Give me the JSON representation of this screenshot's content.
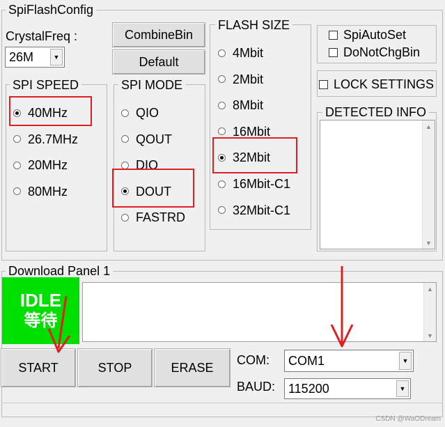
{
  "panel_title": "SpiFlashConfig",
  "crystal": {
    "label": "CrystalFreq :",
    "value": "26M"
  },
  "buttons": {
    "combine": "CombineBin",
    "default": "Default"
  },
  "spi_speed": {
    "title": "SPI SPEED",
    "options": [
      "40MHz",
      "26.7MHz",
      "20MHz",
      "80MHz"
    ],
    "selected": "40MHz"
  },
  "spi_mode": {
    "title": "SPI MODE",
    "options": [
      "QIO",
      "QOUT",
      "DIO",
      "DOUT",
      "FASTRD"
    ],
    "selected": "DOUT"
  },
  "flash_size": {
    "title": "FLASH SIZE",
    "options": [
      "4Mbit",
      "2Mbit",
      "8Mbit",
      "16Mbit",
      "32Mbit",
      "16Mbit-C1",
      "32Mbit-C1"
    ],
    "selected": "32Mbit"
  },
  "checks": {
    "spi_auto_set": "SpiAutoSet",
    "do_not_chg_bin": "DoNotChgBin",
    "lock_settings": "LOCK SETTINGS"
  },
  "detected_info": {
    "title": "DETECTED INFO"
  },
  "download_panel": {
    "title": "Download Panel 1",
    "status_en": "IDLE",
    "status_cn": "等待",
    "status_color": "#00e000"
  },
  "actions": {
    "start": "START",
    "stop": "STOP",
    "erase": "ERASE"
  },
  "com": {
    "label": "COM:",
    "value": "COM1"
  },
  "baud": {
    "label": "BAUD:",
    "value": "115200"
  },
  "watermark": "CSDN @WaODream",
  "accent_red": "#e02020"
}
